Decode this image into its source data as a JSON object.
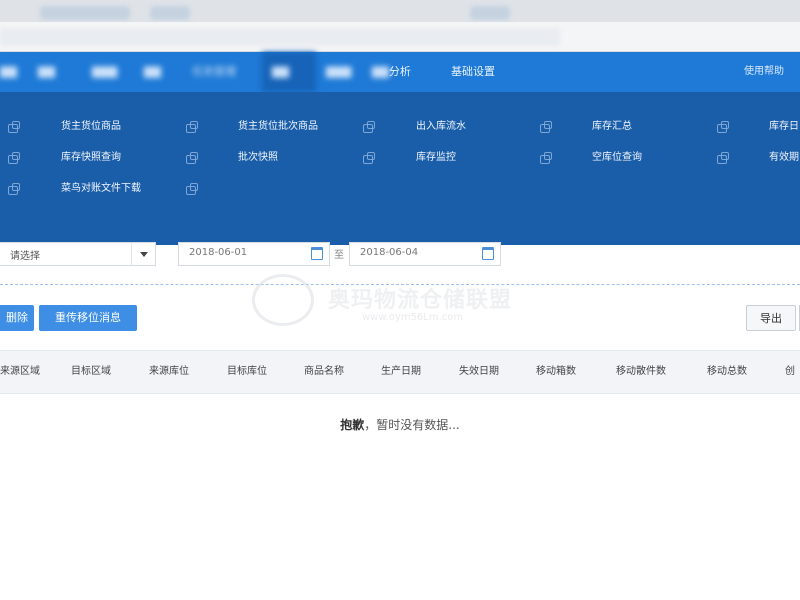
{
  "topnav": {
    "items": [
      {
        "label": "",
        "blurred": true
      },
      {
        "label": "",
        "blurred": true
      },
      {
        "label": "",
        "blurred": true
      },
      {
        "label": "",
        "blurred": true
      },
      {
        "label": "任务管理",
        "blurred": true
      },
      {
        "label": "",
        "blurred": true
      },
      {
        "label": "",
        "blurred": true
      },
      {
        "label": "分析",
        "blurred": false
      },
      {
        "label": "基础设置",
        "blurred": false
      }
    ],
    "help": "使用帮助"
  },
  "mega_menu": {
    "row1": [
      "货主货位商品",
      "货主货位批次商品",
      "出入库流水",
      "库存汇总",
      "库存日"
    ],
    "row2": [
      "库存快照查询",
      "批次快照",
      "库存监控",
      "空库位查询",
      "有效期"
    ],
    "row3": [
      "菜鸟对账文件下载"
    ]
  },
  "filters": {
    "select_placeholder": "请选择",
    "date_from": "2018-06-01",
    "separator": "至",
    "date_to": "2018-06-04"
  },
  "watermark": {
    "brand": "奥玛物流仓储联盟",
    "url": "www.oym56Lm.com"
  },
  "actions": {
    "delete": "删除",
    "resend": "重传移位消息",
    "export": "导出"
  },
  "table": {
    "headers": [
      "来源区域",
      "目标区域",
      "来源库位",
      "目标库位",
      "商品名称",
      "生产日期",
      "失效日期",
      "移动箱数",
      "移动散件数",
      "移动总数",
      "创"
    ],
    "empty_strong": "抱歉",
    "empty_rest": "，暂时没有数据..."
  }
}
